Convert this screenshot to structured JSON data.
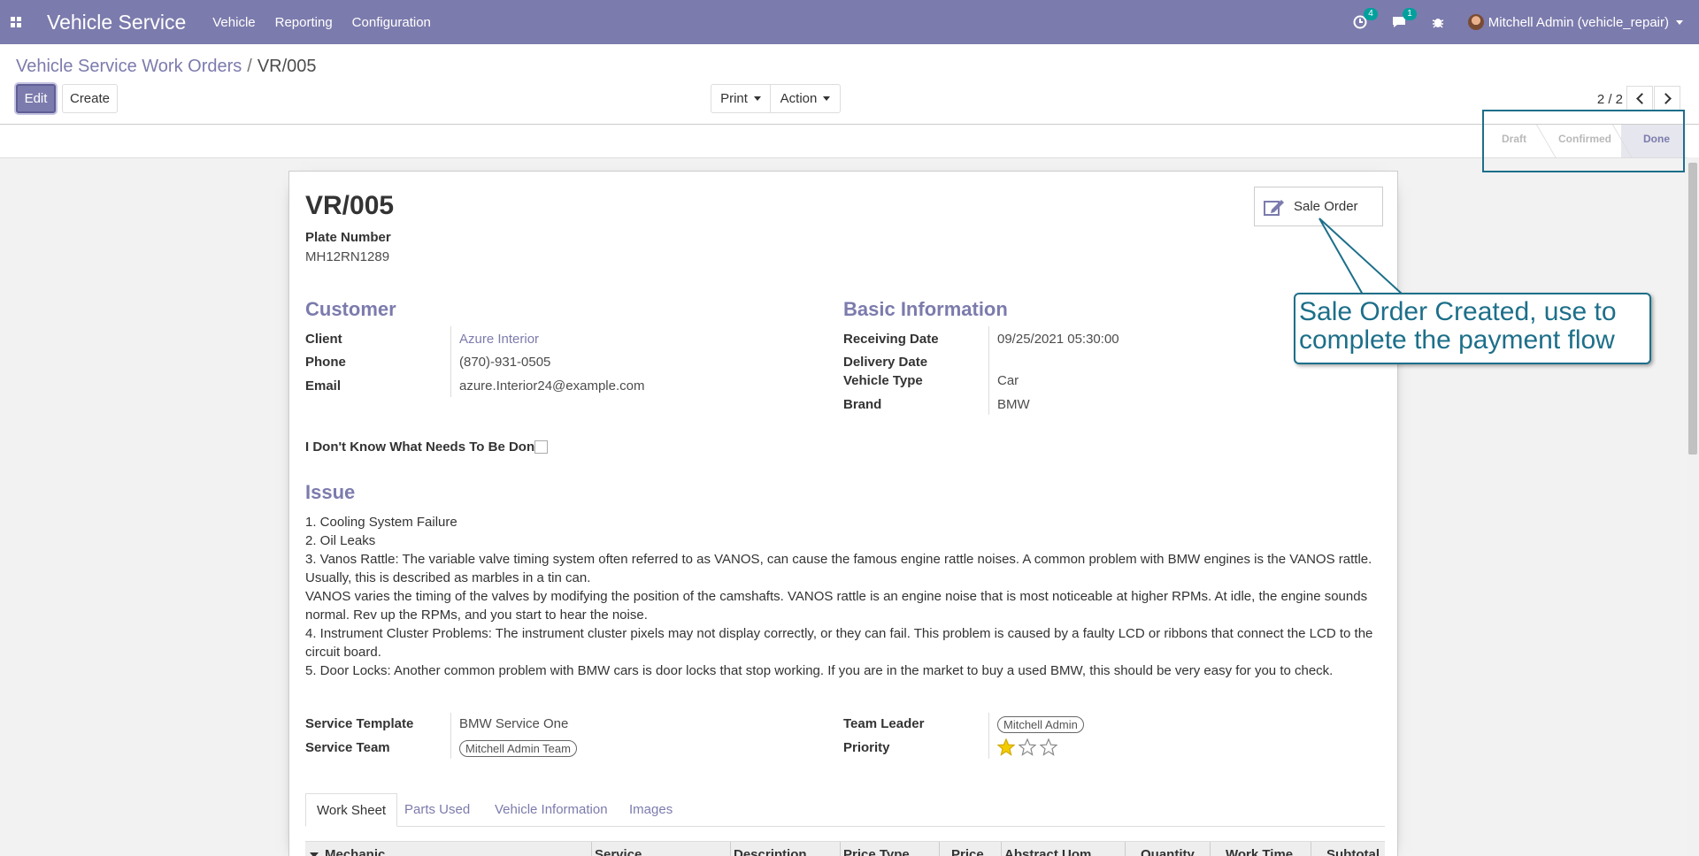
{
  "navbar": {
    "app_name": "Vehicle Service",
    "menu": [
      "Vehicle",
      "Reporting",
      "Configuration"
    ],
    "activity_count": "4",
    "messages_count": "1",
    "user": "Mitchell Admin (vehicle_repair)"
  },
  "breadcrumb": {
    "parent": "Vehicle Service Work Orders",
    "current": "VR/005"
  },
  "buttons": {
    "edit": "Edit",
    "create": "Create",
    "print": "Print",
    "action": "Action"
  },
  "pager": {
    "value": "2 / 2"
  },
  "statusbar": {
    "stages": [
      "Draft",
      "Confirmed",
      "Done"
    ],
    "current": "Done"
  },
  "record": {
    "title": "VR/005",
    "plate_label": "Plate Number",
    "plate": "MH12RN1289",
    "sale_order_button": "Sale Order",
    "customer_section": "Customer",
    "basic_section": "Basic Information",
    "client_label": "Client",
    "client": "Azure Interior",
    "phone_label": "Phone",
    "phone": "(870)-931-0505",
    "email_label": "Email",
    "email": "azure.Interior24@example.com",
    "receiving_label": "Receiving Date",
    "receiving": "09/25/2021 05:30:00",
    "delivery_label": "Delivery Date",
    "delivery": "",
    "vehicle_type_label": "Vehicle Type",
    "vehicle_type": "Car",
    "brand_label": "Brand",
    "brand": "BMW",
    "dont_know_label": "I Don't Know What Needs To Be Done",
    "issue_section": "Issue",
    "issue_lines": [
      "1. Cooling System Failure",
      "2. Oil Leaks",
      "3. Vanos Rattle: The variable valve timing system often referred to as VANOS, can cause the famous engine rattle noises. A common problem with BMW engines is the VANOS rattle. Usually, this is described as marbles in a tin can.",
      "VANOS varies the timing of the valves by modifying the position of the camshafts. VANOS rattle is an engine noise that is most noticeable at higher RPMs. At idle, the engine sounds normal. Rev up the RPMs, and you start to hear the noise.",
      "4. Instrument Cluster Problems: The instrument cluster pixels may not display correctly, or they can fail. This problem is caused by a faulty LCD or ribbons that connect the LCD to the circuit board.",
      "5. Door Locks: Another common problem with BMW cars is door locks that stop working. If you are in the market to buy a used BMW, this should be very easy for you to check."
    ],
    "service_template_label": "Service Template",
    "service_template": "BMW Service One",
    "service_team_label": "Service Team",
    "service_team": "Mitchell Admin Team",
    "team_leader_label": "Team Leader",
    "team_leader": "Mitchell Admin",
    "priority_label": "Priority",
    "priority_stars": 1,
    "priority_max": 3
  },
  "tabs": [
    "Work Sheet",
    "Parts Used",
    "Vehicle Information",
    "Images"
  ],
  "table_headers": [
    "Mechanic",
    "Service",
    "Description",
    "Price Type",
    "Price",
    "Abstract Uom",
    "Quantity",
    "Work Time",
    "Subtotal"
  ],
  "callout": {
    "line1": "Sale Order Created, use to",
    "line2": "complete the payment flow"
  },
  "colors": {
    "brand": "#7c7bad",
    "callout": "#1d6f8a",
    "star": "#f3cc00"
  }
}
